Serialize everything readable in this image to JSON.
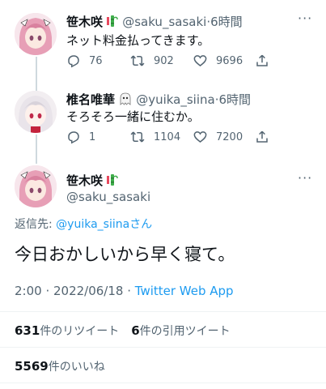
{
  "tweet1": {
    "name": "笹木咲",
    "handle": "@saku_sasaki",
    "time": "6時間",
    "text": "ネット料金払ってきます。",
    "replies": "76",
    "retweets": "902",
    "likes": "9696"
  },
  "tweet2": {
    "name": "椎名唯華",
    "handle": "@yuika_siina",
    "time": "6時間",
    "text": "そろそろ一緒に住むか。",
    "replies": "1",
    "retweets": "1104",
    "likes": "7200"
  },
  "main": {
    "name": "笹木咲",
    "handle": "@saku_sasaki",
    "reply_to_label": "返信先:",
    "reply_to_handle": "@yuika_siina",
    "reply_to_suffix": "さん",
    "text": "今日おかしいから早く寝て。",
    "timestamp": "2:00 · 2022/06/18 ·",
    "source": "Twitter Web App",
    "retweet_count": "631",
    "retweet_label": "件のリツイート",
    "quote_count": "6",
    "quote_label": "件の引用ツイート",
    "like_count": "5569",
    "like_label": "件のいいね"
  },
  "separator": "·",
  "colors": {
    "accent": "#1d9bf0",
    "secondary_text": "#536471",
    "primary_text": "#0f1419"
  }
}
